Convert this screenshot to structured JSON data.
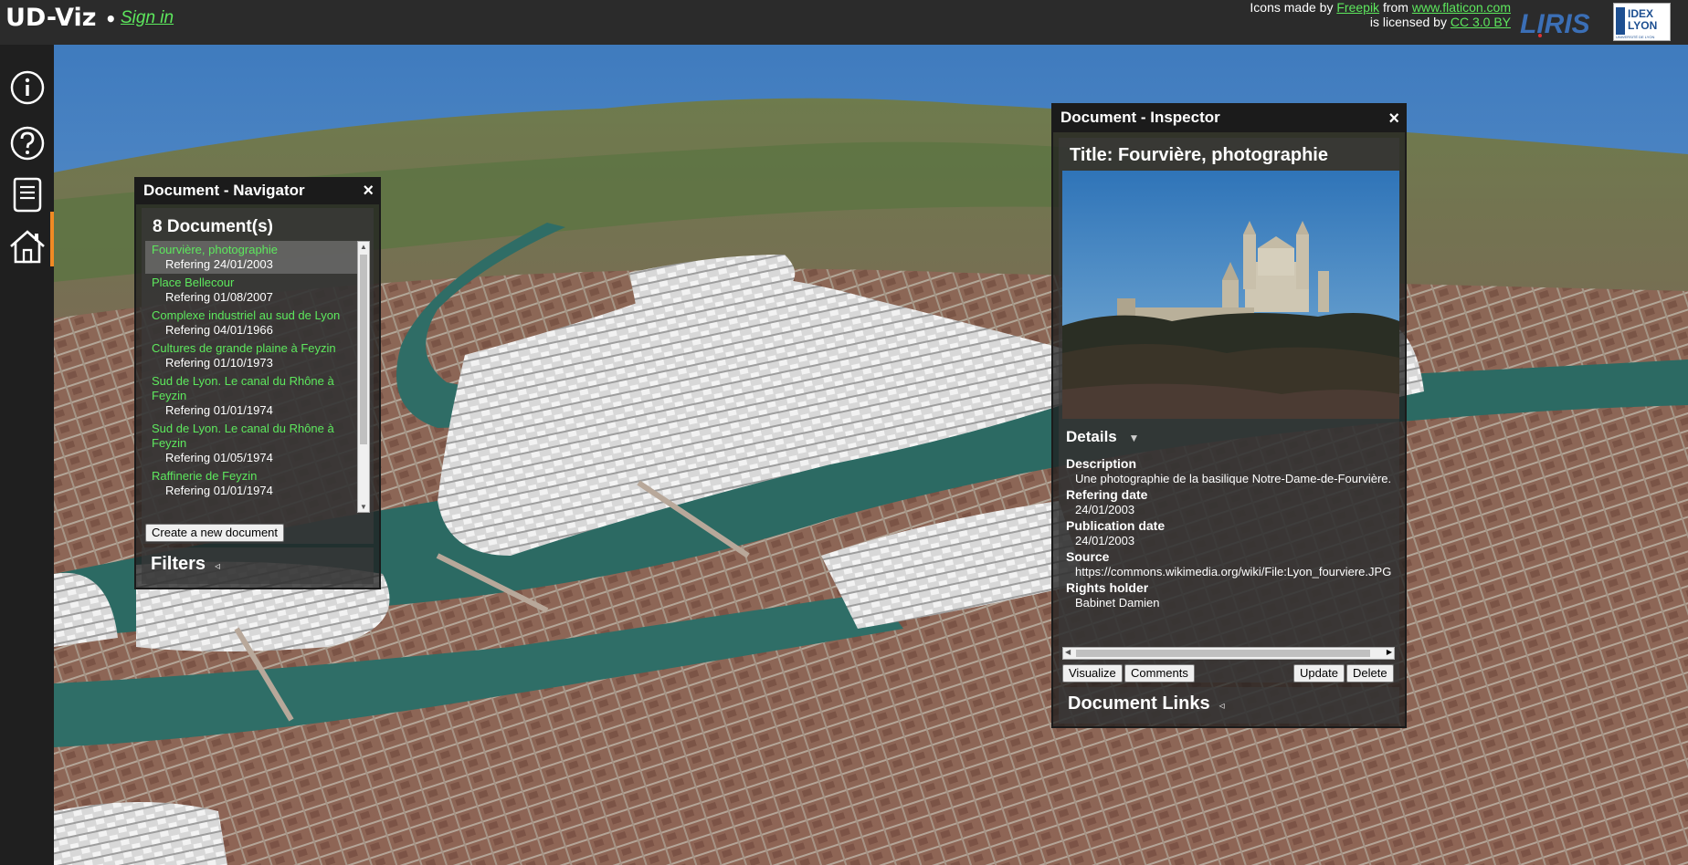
{
  "header": {
    "app_title": "UD-Viz",
    "bullet": "•",
    "sign_in": "Sign in",
    "credits": {
      "prefix": "Icons made by",
      "author": "Freepik",
      "middle": "from",
      "site": "www.flaticon.com",
      "license_prefix": "is licensed by",
      "license": "CC 3.0 BY"
    },
    "logo_liris_text": "LIRIS",
    "logo_idex_line1": "IDEX",
    "logo_idex_line2": "LYON",
    "logo_idex_sub": "UNIVERSITÉ DE LYON"
  },
  "sidebar": {
    "items": [
      {
        "icon": "info-icon"
      },
      {
        "icon": "help-icon"
      },
      {
        "icon": "document-icon",
        "active": true
      },
      {
        "icon": "home-icon"
      }
    ],
    "active_color": "#f08a24"
  },
  "navigator": {
    "title": "Document - Navigator",
    "close": "×",
    "count": "8 Document(s)",
    "documents": [
      {
        "title": "Fourvière, photographie",
        "date": "Refering 24/01/2003"
      },
      {
        "title": "Place Bellecour",
        "date": "Refering 01/08/2007"
      },
      {
        "title": "Complexe industriel au sud de Lyon",
        "date": "Refering 04/01/1966"
      },
      {
        "title": "Cultures de grande plaine à Feyzin",
        "date": "Refering 01/10/1973"
      },
      {
        "title": "Sud de Lyon. Le canal du Rhône à Feyzin",
        "date": "Refering 01/01/1974"
      },
      {
        "title": "Sud de Lyon. Le canal du Rhône à Feyzin",
        "date": "Refering 01/05/1974"
      },
      {
        "title": "Raffinerie de Feyzin",
        "date": "Refering 01/01/1974"
      }
    ],
    "create_button": "Create a new document",
    "filters_label": "Filters",
    "filters_arrow": "◃"
  },
  "inspector": {
    "title": "Document - Inspector",
    "close": "×",
    "doc_title": "Title: Fourvière, photographie",
    "details_label": "Details",
    "details_arrow": "▼",
    "fields": {
      "description_label": "Description",
      "description_value": "Une photographie de la basilique Notre-Dame-de-Fourvière.",
      "refering_label": "Refering date",
      "refering_value": "24/01/2003",
      "publication_label": "Publication date",
      "publication_value": "24/01/2003",
      "source_label": "Source",
      "source_value": "https://commons.wikimedia.org/wiki/File:Lyon_fourviere.JPG",
      "rights_label": "Rights holder",
      "rights_value": "Babinet Damien"
    },
    "buttons": {
      "visualize": "Visualize",
      "comments": "Comments",
      "update": "Update",
      "delete": "Delete"
    },
    "links_label": "Document Links",
    "links_arrow": "◃"
  },
  "colors": {
    "link_green": "#5de85d",
    "header_bg": "#2b2b2b",
    "sidebar_bg": "#1f1f1f"
  }
}
